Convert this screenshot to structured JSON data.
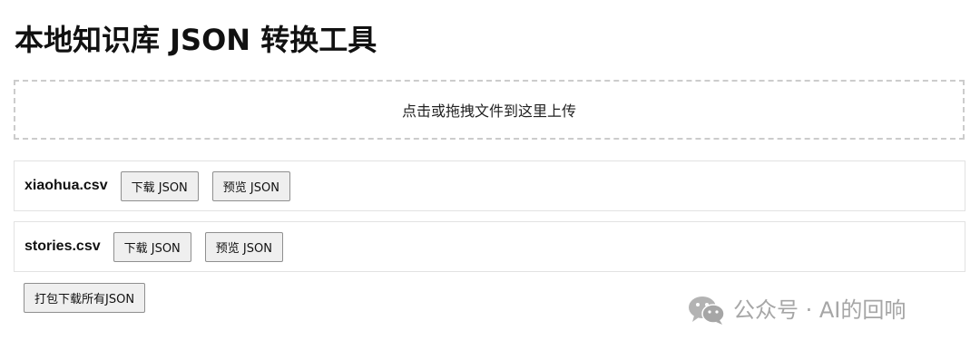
{
  "page": {
    "title": "本地知识库 JSON 转换工具"
  },
  "upload": {
    "prompt": "点击或拖拽文件到这里上传"
  },
  "files": [
    {
      "name": "xiaohua.csv",
      "download_label": "下载 JSON",
      "preview_label": "预览 JSON"
    },
    {
      "name": "stories.csv",
      "download_label": "下载 JSON",
      "preview_label": "预览 JSON"
    }
  ],
  "actions": {
    "download_all_label": "打包下载所有JSON"
  },
  "watermark": {
    "icon": "wechat-icon",
    "text": "公众号 · AI的回响"
  },
  "colors": {
    "background": "#ffffff",
    "dashed_border": "#cccccc",
    "row_border": "#e2e2e2",
    "button_bg": "#efefef",
    "button_border": "#8f8f8f",
    "watermark": "#a6a6a6"
  }
}
